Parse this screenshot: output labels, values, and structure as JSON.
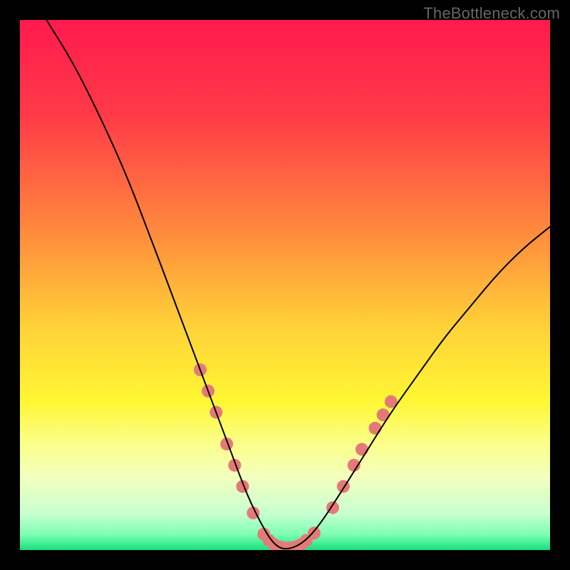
{
  "watermark": "TheBottleneck.com",
  "chart_data": {
    "type": "line",
    "title": "",
    "xlabel": "",
    "ylabel": "",
    "xlim": [
      0,
      100
    ],
    "ylim": [
      0,
      100
    ],
    "grid": false,
    "legend": false,
    "background": {
      "type": "vertical_gradient",
      "stops": [
        {
          "pos": 0.0,
          "color": "#ff1a4e"
        },
        {
          "pos": 0.18,
          "color": "#ff3a47"
        },
        {
          "pos": 0.38,
          "color": "#ff833d"
        },
        {
          "pos": 0.58,
          "color": "#ffd238"
        },
        {
          "pos": 0.72,
          "color": "#fff734"
        },
        {
          "pos": 0.8,
          "color": "#fbff8a"
        },
        {
          "pos": 0.86,
          "color": "#f3ffbc"
        },
        {
          "pos": 0.93,
          "color": "#c9ffd1"
        },
        {
          "pos": 0.97,
          "color": "#7fffb2"
        },
        {
          "pos": 1.0,
          "color": "#18e07f"
        }
      ]
    },
    "series": [
      {
        "name": "bottleneck-curve",
        "color": "#000000",
        "stroke_width": 2,
        "x": [
          5,
          10,
          15,
          20,
          25,
          28,
          31,
          34,
          37,
          40,
          43,
          46,
          48,
          50,
          53,
          56,
          60,
          65,
          70,
          75,
          80,
          85,
          90,
          95,
          100
        ],
        "y": [
          100,
          92,
          82,
          71,
          58,
          50,
          42,
          34,
          26,
          18,
          10,
          4,
          1,
          0,
          1,
          4,
          10,
          18,
          26,
          33,
          40,
          46,
          52,
          57,
          61
        ]
      }
    ],
    "markers": {
      "name": "highlight-dots",
      "color": "#e47a78",
      "radius": 9,
      "points": [
        {
          "x": 34,
          "y": 34
        },
        {
          "x": 35.5,
          "y": 30
        },
        {
          "x": 37,
          "y": 26
        },
        {
          "x": 39,
          "y": 20
        },
        {
          "x": 40.5,
          "y": 16
        },
        {
          "x": 42,
          "y": 12
        },
        {
          "x": 44,
          "y": 7
        },
        {
          "x": 46,
          "y": 3
        },
        {
          "x": 47,
          "y": 1.8
        },
        {
          "x": 48,
          "y": 1
        },
        {
          "x": 49,
          "y": 0.6
        },
        {
          "x": 50,
          "y": 0.4
        },
        {
          "x": 51,
          "y": 0.4
        },
        {
          "x": 52,
          "y": 0.6
        },
        {
          "x": 53,
          "y": 1
        },
        {
          "x": 54,
          "y": 1.8
        },
        {
          "x": 55.5,
          "y": 3.2
        },
        {
          "x": 59,
          "y": 8
        },
        {
          "x": 61,
          "y": 12
        },
        {
          "x": 63,
          "y": 16
        },
        {
          "x": 64.5,
          "y": 19
        },
        {
          "x": 67,
          "y": 23
        },
        {
          "x": 68.5,
          "y": 25.5
        },
        {
          "x": 70,
          "y": 28
        }
      ]
    }
  }
}
